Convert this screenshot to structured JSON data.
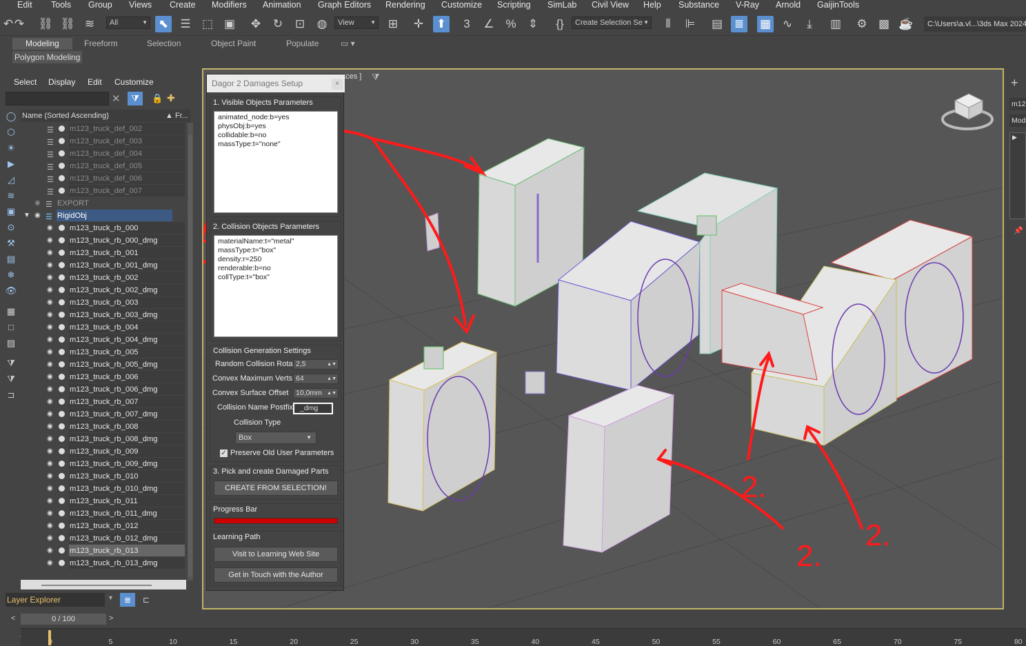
{
  "menu": [
    "Edit",
    "Tools",
    "Group",
    "Views",
    "Create",
    "Modifiers",
    "Animation",
    "Graph Editors",
    "Rendering",
    "Customize",
    "Scripting",
    "SimLab",
    "Civil View",
    "Help",
    "Substance",
    "V-Ray",
    "Arnold",
    "GaijinTools"
  ],
  "toolbar": {
    "filter_dropdown": "All",
    "view_dropdown": "View",
    "selection_set": "Create Selection Se",
    "path": "C:\\Users\\a.vl...\\3ds Max 2024"
  },
  "ribbon": {
    "tabs": [
      "Modeling",
      "Freeform",
      "Selection",
      "Object Paint",
      "Populate"
    ],
    "sub": "Polygon Modeling"
  },
  "scene_explorer": {
    "menu": [
      "Select",
      "Display",
      "Edit",
      "Customize"
    ],
    "column_header": "Name (Sorted Ascending)",
    "column_header2": "▲ Fr...",
    "rows": [
      {
        "name": "m123_truck_def_002",
        "kind": "def"
      },
      {
        "name": "m123_truck_def_003",
        "kind": "def"
      },
      {
        "name": "m123_truck_def_004",
        "kind": "def"
      },
      {
        "name": "m123_truck_def_005",
        "kind": "def"
      },
      {
        "name": "m123_truck_def_006",
        "kind": "def"
      },
      {
        "name": "m123_truck_def_007",
        "kind": "def"
      },
      {
        "name": "EXPORT",
        "kind": "lay"
      },
      {
        "name": "RigidObj",
        "kind": "blue"
      },
      {
        "name": "m123_truck_rb_000",
        "kind": "obj"
      },
      {
        "name": "m123_truck_rb_000_dmg",
        "kind": "obj"
      },
      {
        "name": "m123_truck_rb_001",
        "kind": "obj"
      },
      {
        "name": "m123_truck_rb_001_dmg",
        "kind": "obj"
      },
      {
        "name": "m123_truck_rb_002",
        "kind": "obj"
      },
      {
        "name": "m123_truck_rb_002_dmg",
        "kind": "obj"
      },
      {
        "name": "m123_truck_rb_003",
        "kind": "obj"
      },
      {
        "name": "m123_truck_rb_003_dmg",
        "kind": "obj"
      },
      {
        "name": "m123_truck_rb_004",
        "kind": "obj"
      },
      {
        "name": "m123_truck_rb_004_dmg",
        "kind": "obj"
      },
      {
        "name": "m123_truck_rb_005",
        "kind": "obj"
      },
      {
        "name": "m123_truck_rb_005_dmg",
        "kind": "obj"
      },
      {
        "name": "m123_truck_rb_006",
        "kind": "obj"
      },
      {
        "name": "m123_truck_rb_006_dmg",
        "kind": "obj"
      },
      {
        "name": "m123_truck_rb_007",
        "kind": "obj"
      },
      {
        "name": "m123_truck_rb_007_dmg",
        "kind": "obj"
      },
      {
        "name": "m123_truck_rb_008",
        "kind": "obj"
      },
      {
        "name": "m123_truck_rb_008_dmg",
        "kind": "obj"
      },
      {
        "name": "m123_truck_rb_009",
        "kind": "obj"
      },
      {
        "name": "m123_truck_rb_009_dmg",
        "kind": "obj"
      },
      {
        "name": "m123_truck_rb_010",
        "kind": "obj"
      },
      {
        "name": "m123_truck_rb_010_dmg",
        "kind": "obj"
      },
      {
        "name": "m123_truck_rb_011",
        "kind": "obj"
      },
      {
        "name": "m123_truck_rb_011_dmg",
        "kind": "obj"
      },
      {
        "name": "m123_truck_rb_012",
        "kind": "obj"
      },
      {
        "name": "m123_truck_rb_012_dmg",
        "kind": "obj"
      },
      {
        "name": "m123_truck_rb_013",
        "kind": "sel"
      },
      {
        "name": "m123_truck_rb_013_dmg",
        "kind": "obj"
      }
    ],
    "layer_explorer": "Layer Explorer"
  },
  "viewport": {
    "label": "aces ]"
  },
  "dialog": {
    "title": "Dagor 2 Damages Setup",
    "close": "×",
    "visible_group": "1. Visible Objects Parameters",
    "visible_text": "animated_node:b=yes\nphysObj:b=yes\ncollidable:b=no\nmassType:t=\"none\"",
    "collision_group": "2. Collision Objects Parameters",
    "collision_text": "materialName:t=\"metal\"\nmassType:t=\"box\"\ndensity:r=250\nrenderable:b=no\ncollType:t=\"box\"",
    "gen_group": "Collision Generation Settings",
    "random_rot_label": "Random Collision Rotation",
    "random_rot_value": "2,5",
    "convex_verts_label": "Convex Maximum Verts",
    "convex_verts_value": "64",
    "convex_offset_label": "Convex Surface Offset",
    "convex_offset_value": "10,0mm",
    "postfix_label": "Collision Name Postfix",
    "postfix_value": "_dmg",
    "coll_type_label": "Collision Type",
    "coll_type_value": "Box",
    "preserve_label": "Preserve Old User Parameters",
    "pick_group": "3. Pick and create Damaged Parts",
    "create_button": "CREATE FROM SELECTION!",
    "progress_group": "Progress Bar",
    "progress": 1.0,
    "learning_group": "Learning Path",
    "learning_button": "Visit to Learning Web Site",
    "author_button": "Get in Touch with the Author"
  },
  "timeline": {
    "frame": "0 / 100",
    "ticks": [
      "0",
      "5",
      "10",
      "15",
      "20",
      "25",
      "30",
      "35",
      "40",
      "45",
      "50",
      "55",
      "60",
      "65",
      "70",
      "75",
      "80"
    ]
  },
  "right_panel": {
    "items": [
      "m12",
      "Mod"
    ]
  },
  "annotations": {
    "labels": [
      "2.",
      "2.",
      "2."
    ]
  },
  "colors": {
    "accent": "#5b8fd0",
    "annotation": "#ff1a1a",
    "viewport_border": "#c2b468",
    "progress": "#cc0000"
  }
}
